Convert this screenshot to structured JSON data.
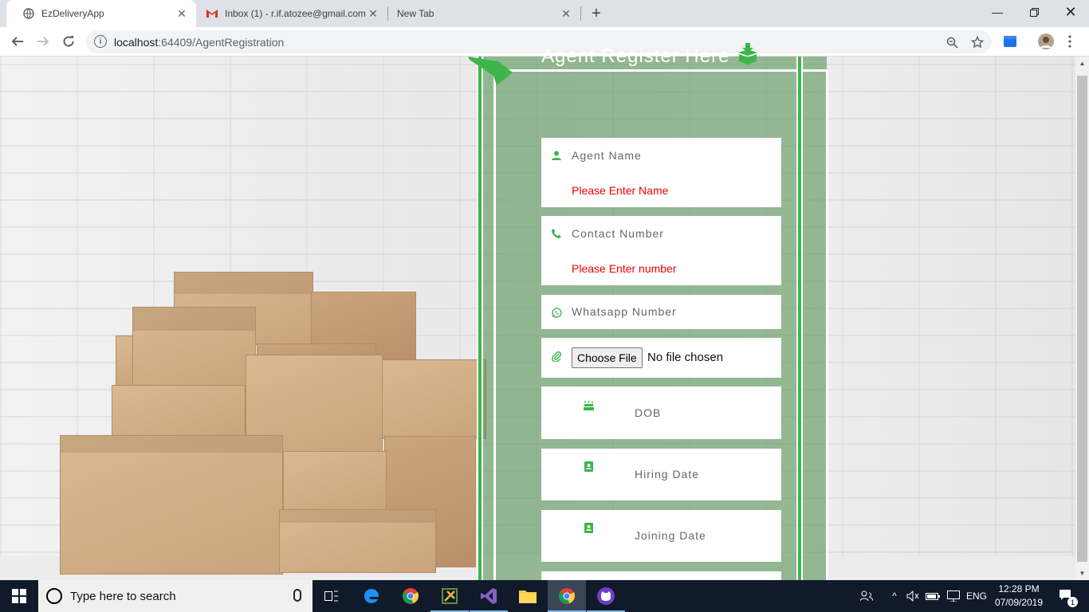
{
  "browser": {
    "tabs": [
      {
        "title": "EzDeliveryApp",
        "icon": "globe-icon",
        "active": true
      },
      {
        "title": "Inbox (1) - r.if.atozee@gmail.com",
        "icon": "gmail-icon",
        "active": false
      },
      {
        "title": "New Tab",
        "icon": "",
        "active": false
      }
    ],
    "url_host": "localhost",
    "url_rest": ":64409/AgentRegistration"
  },
  "form": {
    "title": "Agent Register Here",
    "fields": {
      "agent_name": {
        "placeholder": "Agent Name",
        "error": "Please Enter Name",
        "icon": "user-icon"
      },
      "contact_number": {
        "placeholder": "Contact Number",
        "error": "Please Enter number",
        "icon": "phone-icon"
      },
      "whatsapp_number": {
        "placeholder": "Whatsapp Number",
        "icon": "whatsapp-icon"
      },
      "file": {
        "button": "Choose File",
        "status": "No file chosen",
        "icon": "paperclip-icon"
      },
      "dob": {
        "placeholder": "DOB",
        "icon": "birthday-cake-icon"
      },
      "hiring_date": {
        "placeholder": "Hiring Date",
        "icon": "contact-card-icon"
      },
      "joining_date": {
        "placeholder": "Joining Date",
        "icon": "contact-card-icon"
      }
    }
  },
  "taskbar": {
    "search_placeholder": "Type here to search",
    "language": "ENG",
    "time": "12:28 PM",
    "date": "07/09/2019",
    "notification_count": "1"
  },
  "colors": {
    "accent_green": "#3db54a",
    "error_red": "#e00000",
    "panel_green": "#5c965c"
  }
}
